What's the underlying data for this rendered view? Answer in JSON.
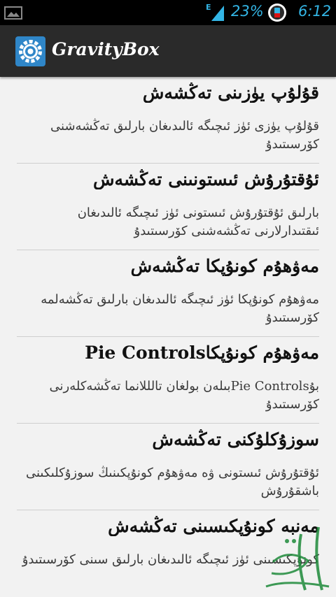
{
  "status_bar": {
    "network_label": "E",
    "battery_percent": "23%",
    "time": "6:12",
    "accent_color": "#33b5e5"
  },
  "action_bar": {
    "app_title": "GravityBox",
    "icon": "settings-gear-icon"
  },
  "list": [
    {
      "title": "قۇلۇپ يۈزىنى تەڭشەش",
      "summary": "قۇلۇپ يۈزى ئۈز ئىچىگە ئالىدىغان بارلىق تەڭشەشنى كۆرسىتىدۇ"
    },
    {
      "title": "ئۇقتۇرۇش ئىستونىنى تەڭشەش",
      "summary": "بارلىق ئۇقتۇرۇش ئىستونى ئۈز ئىچىگە ئالىدىغان ئىقتىدارلارنى تەڭشەشنى كۆرسىتىدۇ"
    },
    {
      "title": "مەۋھۇم كونۇپكا تەڭشەش",
      "summary": "مەۋھۇم كونۇپكا ئۈز ئىچىگە ئالىدىغان بارلىق تەڭشەلمە كۆرسىتىدۇ"
    },
    {
      "title": "مەۋھۇم كونۇپكاPie Controls",
      "summary": "بۇPie Controlsبىلەن بولغان تالللانما تەڭشەكلەرنى كۆرسىتىدۇ"
    },
    {
      "title": "سوزۇكلۇكنى تەڭشەش",
      "summary": "ئۇقتۇرۇش ئىستونى ۋە مەۋھۇم كونۇپكىنىڭ سوزۇكلىكىنى باشقۇرۇش"
    },
    {
      "title": "مەنبە كونۇپكىسىنى تەڭشەش",
      "summary": "كونۇپكىسىنى ئۈز ئىچىگە ئالىدىغان بارلىق سىنى كۆرسىتىدۇ"
    }
  ]
}
